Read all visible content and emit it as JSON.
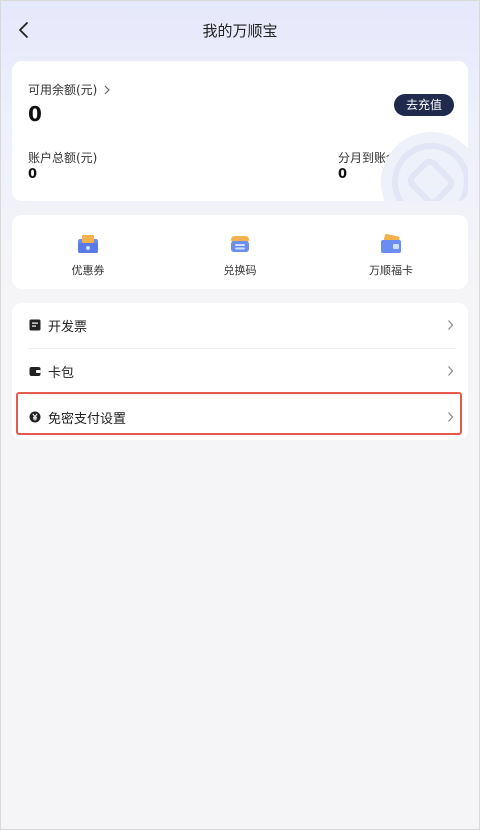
{
  "header": {
    "title": "我的万顺宝"
  },
  "balance": {
    "available_label": "可用余额(元)",
    "available_value": "0",
    "recharge_label": "去充值",
    "total_label": "账户总额(元)",
    "total_value": "0",
    "installment_label": "分月到账余额(元)",
    "installment_value": "0"
  },
  "shortcuts": [
    {
      "label": "优惠券",
      "icon": "coupon-icon"
    },
    {
      "label": "兑换码",
      "icon": "redeem-code-icon"
    },
    {
      "label": "万顺福卡",
      "icon": "gift-card-icon"
    }
  ],
  "menu": [
    {
      "label": "开发票",
      "icon": "invoice-icon"
    },
    {
      "label": "卡包",
      "icon": "wallet-icon"
    },
    {
      "label": "免密支付设置",
      "icon": "yuan-icon"
    }
  ],
  "colors": {
    "accent_dark": "#1f2a4d",
    "highlight": "#e55a4a",
    "icon_blue": "#6b8cf0"
  }
}
